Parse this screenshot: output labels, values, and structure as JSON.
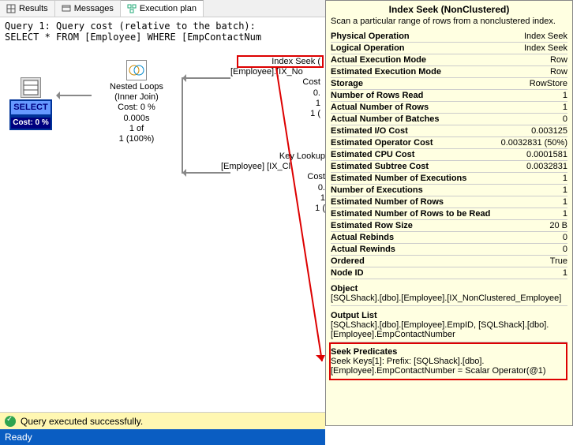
{
  "tabs": {
    "results": "Results",
    "messages": "Messages",
    "plan": "Execution plan"
  },
  "query": {
    "line1": "Query 1: Query cost (relative to the batch):",
    "line2": "SELECT * FROM [Employee] WHERE [EmpContactNum"
  },
  "nodes": {
    "select": {
      "label": "SELECT",
      "cost": "Cost: 0 %"
    },
    "nested": {
      "l1": "Nested Loops",
      "l2": "(Inner Join)",
      "l3": "Cost: 0 %",
      "l4": "0.000s",
      "l5": "1 of",
      "l6": "1 (100%)"
    },
    "seek": {
      "l1": "Index Seek (",
      "l2": "[Employee].[IX_No",
      "l3": "Cost",
      "l4": "0.",
      "l5": "1",
      "l6": "1 ("
    },
    "lookup": {
      "l1": "Key Lookup",
      "l2": "[Employee] [IX_Cl",
      "l3": "Cost",
      "l4": "0.",
      "l5": "1",
      "l6": "1 ("
    }
  },
  "tooltip": {
    "title": "Index Seek (NonClustered)",
    "desc": "Scan a particular range of rows from a nonclustered index.",
    "rows": [
      [
        "Physical Operation",
        "Index Seek"
      ],
      [
        "Logical Operation",
        "Index Seek"
      ],
      [
        "Actual Execution Mode",
        "Row"
      ],
      [
        "Estimated Execution Mode",
        "Row"
      ],
      [
        "Storage",
        "RowStore"
      ],
      [
        "Number of Rows Read",
        "1"
      ],
      [
        "Actual Number of Rows",
        "1"
      ],
      [
        "Actual Number of Batches",
        "0"
      ],
      [
        "Estimated I/O Cost",
        "0.003125"
      ],
      [
        "Estimated Operator Cost",
        "0.0032831 (50%)"
      ],
      [
        "Estimated CPU Cost",
        "0.0001581"
      ],
      [
        "Estimated Subtree Cost",
        "0.0032831"
      ],
      [
        "Estimated Number of Executions",
        "1"
      ],
      [
        "Number of Executions",
        "1"
      ],
      [
        "Estimated Number of Rows",
        "1"
      ],
      [
        "Estimated Number of Rows to be Read",
        "1"
      ],
      [
        "Estimated Row Size",
        "20 B"
      ],
      [
        "Actual Rebinds",
        "0"
      ],
      [
        "Actual Rewinds",
        "0"
      ],
      [
        "Ordered",
        "True"
      ],
      [
        "Node ID",
        "1"
      ]
    ],
    "object_head": "Object",
    "object_body": "[SQLShack].[dbo].[Employee].[IX_NonClustered_Employee]",
    "output_head": "Output List",
    "output_body": "[SQLShack].[dbo].[Employee].EmpID, [SQLShack].[dbo].[Employee].EmpContactNumber",
    "seek_head": "Seek Predicates",
    "seek_body": "Seek Keys[1]: Prefix: [SQLShack].[dbo].[Employee].EmpContactNumber = Scalar Operator(@1)"
  },
  "status": "Query executed successfully.",
  "ready": "Ready"
}
